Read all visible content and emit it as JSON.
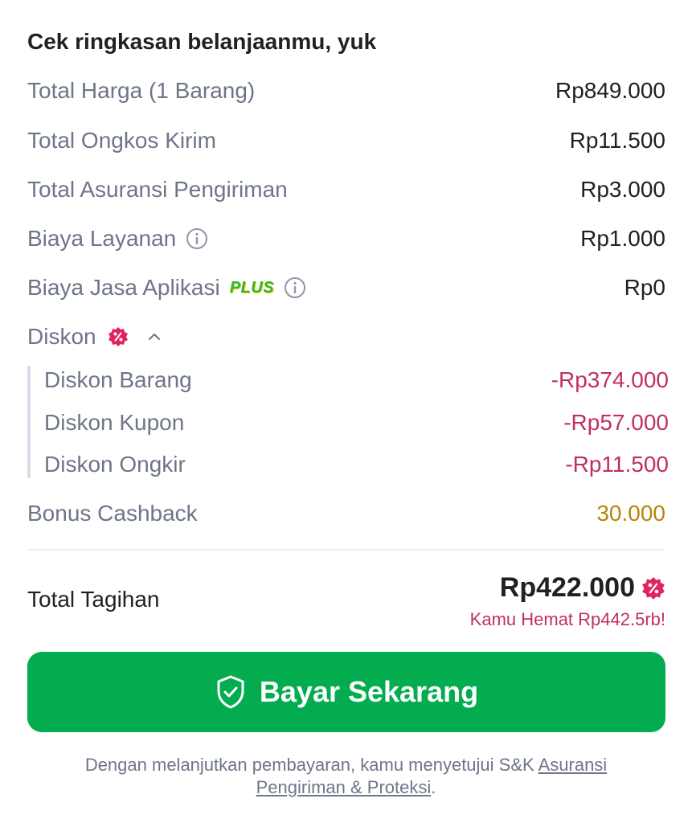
{
  "summary": {
    "title": "Cek ringkasan belanjaanmu, yuk",
    "rows": [
      {
        "label": "Total Harga (1 Barang)",
        "value": "Rp849.000"
      },
      {
        "label": "Total Ongkos Kirim",
        "value": "Rp11.500"
      },
      {
        "label": "Total Asuransi Pengiriman",
        "value": "Rp3.000"
      },
      {
        "label": "Biaya Layanan",
        "value": "Rp1.000"
      },
      {
        "label": "Biaya Jasa Aplikasi",
        "badge": "PLUS",
        "value": "Rp0"
      }
    ],
    "discount": {
      "label": "Diskon",
      "items": [
        {
          "label": "Diskon Barang",
          "value": "-Rp374.000"
        },
        {
          "label": "Diskon Kupon",
          "value": "-Rp57.000"
        },
        {
          "label": "Diskon Ongkir",
          "value": "-Rp11.500"
        }
      ]
    },
    "cashback": {
      "label": "Bonus Cashback",
      "value": "30.000"
    }
  },
  "total": {
    "label": "Total Tagihan",
    "amount": "Rp422.000",
    "savings": "Kamu Hemat Rp442.5rb!"
  },
  "pay_button": {
    "label": "Bayar Sekarang"
  },
  "legal": {
    "text": "Dengan melanjutkan pembayaran, kamu menyetujui S&K ",
    "link": "Asuransi Pengiriman & Proteksi",
    "suffix": "."
  },
  "colors": {
    "primary_green": "#03ac4f",
    "discount_red": "#c0305a",
    "cashback_gold": "#b8860b",
    "muted_text": "#6d7588"
  },
  "icons": [
    "info-icon",
    "discount-badge-icon",
    "chevron-up-icon",
    "shield-check-icon"
  ]
}
